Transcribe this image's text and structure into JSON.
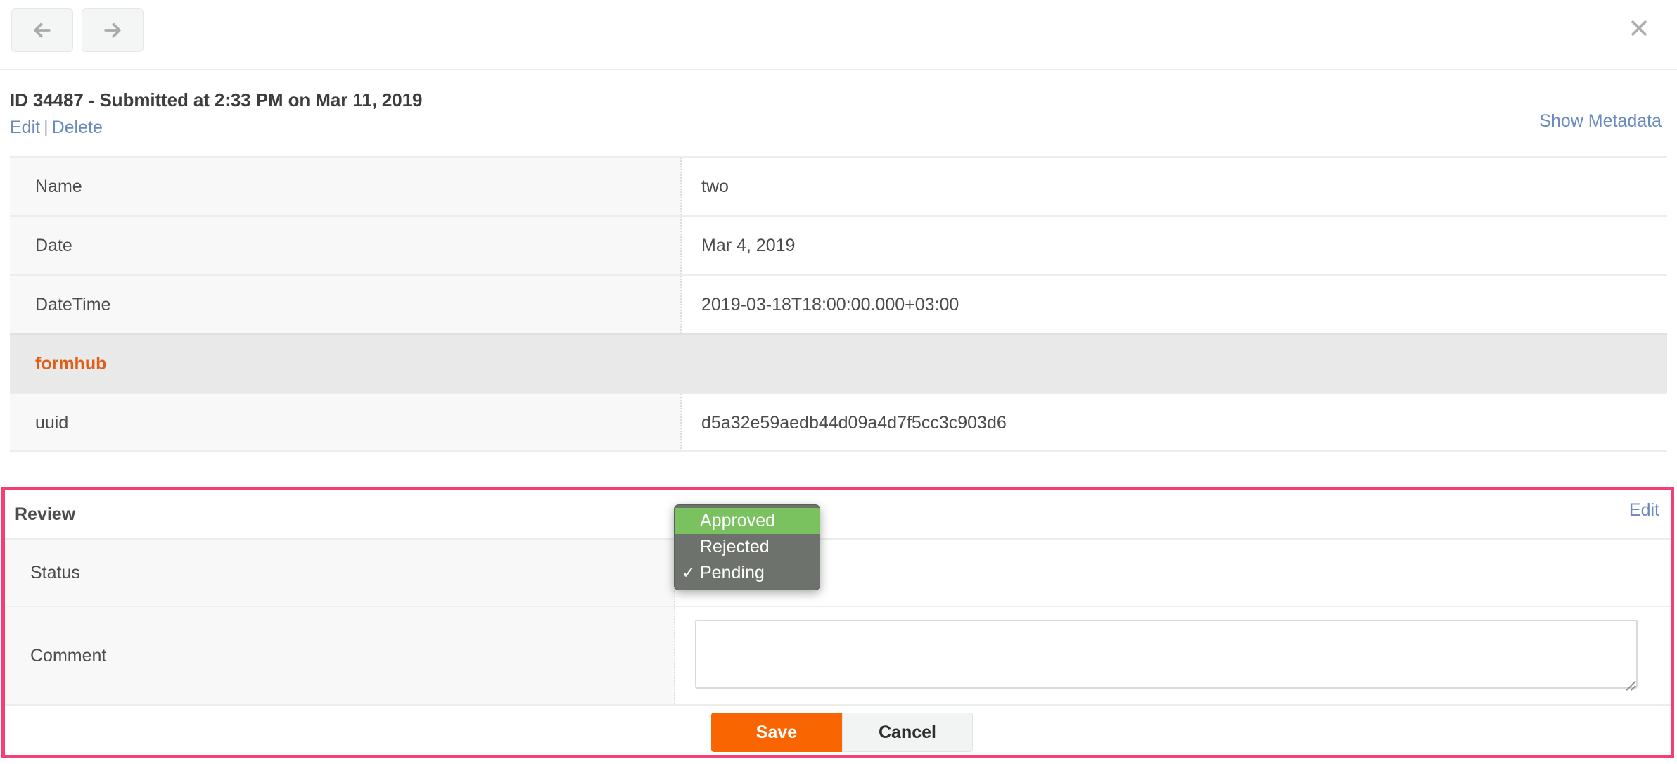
{
  "topbar": {
    "prev_label": "previous submission",
    "next_label": "next submission",
    "close_label": "close"
  },
  "submission": {
    "title": "ID 34487 - Submitted at 2:33 PM on Mar 11, 2019",
    "edit_label": "Edit",
    "separator": "|",
    "delete_label": "Delete",
    "show_metadata_label": "Show Metadata"
  },
  "table": {
    "rows": [
      {
        "type": "field",
        "label": "Name",
        "value": "two"
      },
      {
        "type": "field",
        "label": "Date",
        "value": "Mar 4, 2019"
      },
      {
        "type": "field",
        "label": "DateTime",
        "value": "2019-03-18T18:00:00.000+03:00"
      },
      {
        "type": "group",
        "label": "formhub",
        "value": ""
      },
      {
        "type": "field",
        "label": "uuid",
        "value": "d5a32e59aedb44d09a4d7f5cc3c903d6"
      }
    ]
  },
  "review": {
    "title": "Review",
    "edit_label": "Edit",
    "status_label": "Status",
    "status_value": "Pending",
    "comment_label": "Comment",
    "comment_value": "",
    "comment_placeholder": "",
    "save_label": "Save",
    "cancel_label": "Cancel"
  },
  "status_dropdown": {
    "open": true,
    "options": [
      {
        "label": "Approved",
        "selected": false,
        "highlighted": true,
        "check": ""
      },
      {
        "label": "Rejected",
        "selected": false,
        "highlighted": false,
        "check": ""
      },
      {
        "label": "Pending",
        "selected": true,
        "highlighted": false,
        "check": "✓"
      }
    ]
  },
  "colors": {
    "accent_orange": "#f96500",
    "link_blue": "#6989c0",
    "highlight_pink": "#f43f73",
    "group_orange": "#e05d14",
    "menu_green": "#7ac15f",
    "menu_grey": "#6e726c"
  }
}
